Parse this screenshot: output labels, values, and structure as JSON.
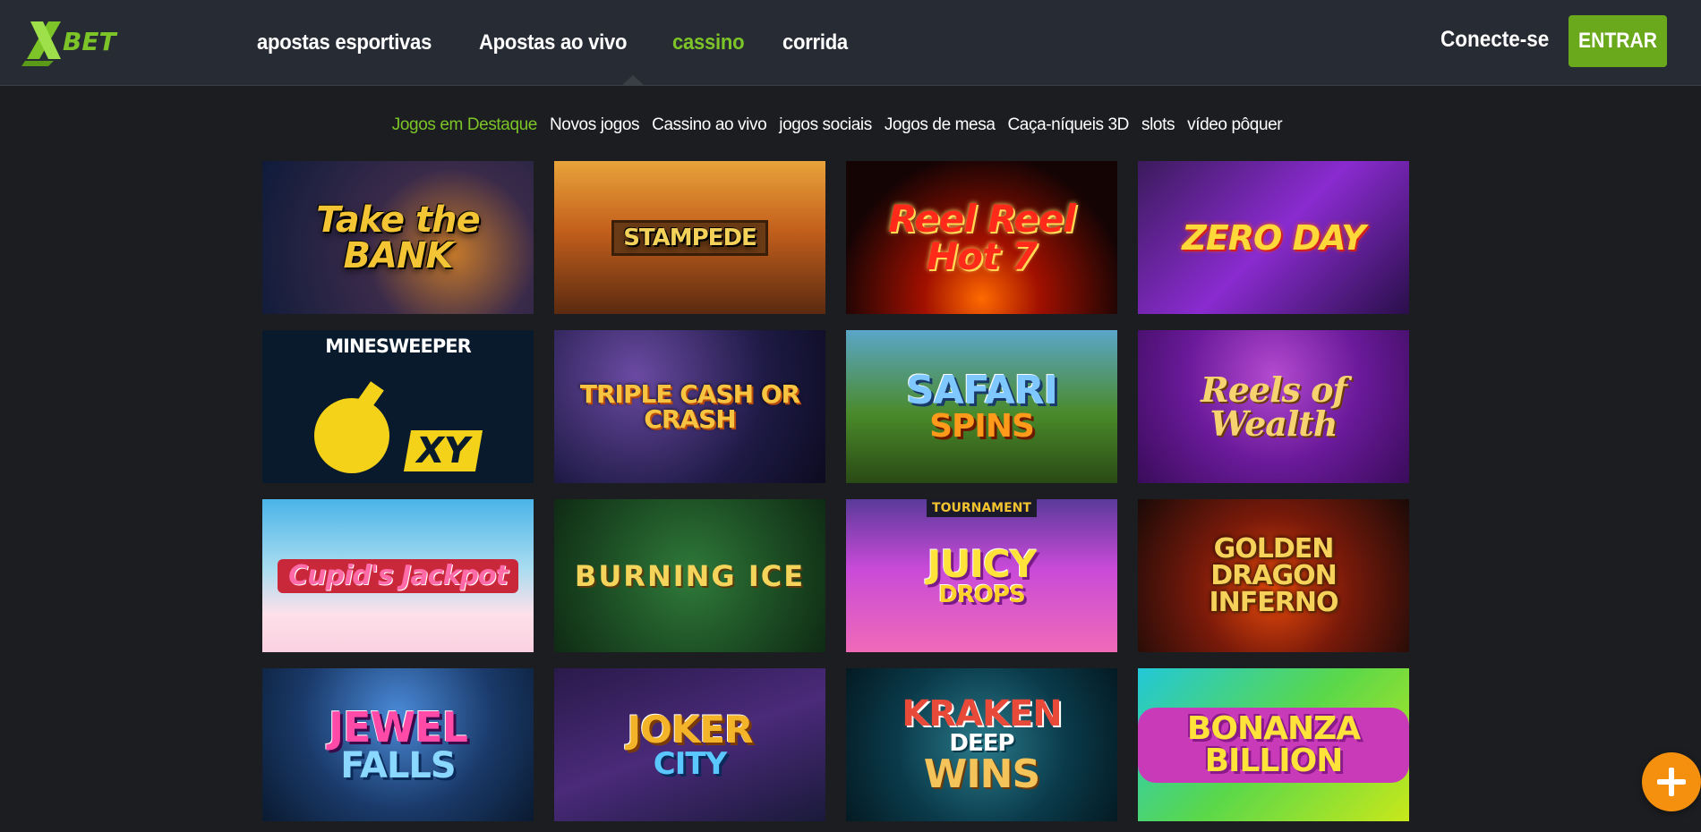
{
  "brand": {
    "logo_text": "XBET",
    "accent": "#7cc428",
    "header_bg": "#272b33",
    "page_bg": "#1b1d20"
  },
  "nav": {
    "items": [
      {
        "label": "apostas esportivas",
        "active": false
      },
      {
        "label": "Apostas ao vivo",
        "active": false
      },
      {
        "label": "cassino",
        "active": true
      },
      {
        "label": "corrida",
        "active": false
      }
    ]
  },
  "auth": {
    "login_label": "Conecte-se",
    "enter_label": "ENTRAR",
    "enter_color": "#6aa81c"
  },
  "categories": [
    {
      "label": "Jogos em Destaque",
      "active": true
    },
    {
      "label": "Novos jogos",
      "active": false
    },
    {
      "label": "Cassino ao vivo",
      "active": false
    },
    {
      "label": "jogos sociais",
      "active": false
    },
    {
      "label": "Jogos de mesa",
      "active": false
    },
    {
      "label": "Caça-níqueis 3D",
      "active": false
    },
    {
      "label": "slots",
      "active": false
    },
    {
      "label": "vídeo pôquer",
      "active": false
    }
  ],
  "games": [
    {
      "title": "Take the BANK"
    },
    {
      "title": "STAMPEDE"
    },
    {
      "title": "Reel Reel Hot 7"
    },
    {
      "title": "ZERO DAY"
    },
    {
      "title": "MINESWEEPER",
      "badge": "XY"
    },
    {
      "title": "TRIPLE CASH OR CRASH"
    },
    {
      "title": "SAFARI",
      "subtitle": "SPINS"
    },
    {
      "title": "Reels of Wealth"
    },
    {
      "title": "Cupid's Jackpot"
    },
    {
      "title": "BURNING ICE"
    },
    {
      "title": "JUICY",
      "subtitle": "DROPS",
      "badge": "TOURNAMENT"
    },
    {
      "title": "GOLDEN DRAGON INFERNO"
    },
    {
      "title": "JEWEL",
      "subtitle": "FALLS"
    },
    {
      "title": "JOKER",
      "subtitle": "CITY"
    },
    {
      "title": "KRAKEN",
      "middle": "DEEP",
      "subtitle": "WINS"
    },
    {
      "title": "BONANZA BILLION"
    }
  ],
  "fab": {
    "icon": "plus-icon",
    "color": "#f5900f"
  }
}
